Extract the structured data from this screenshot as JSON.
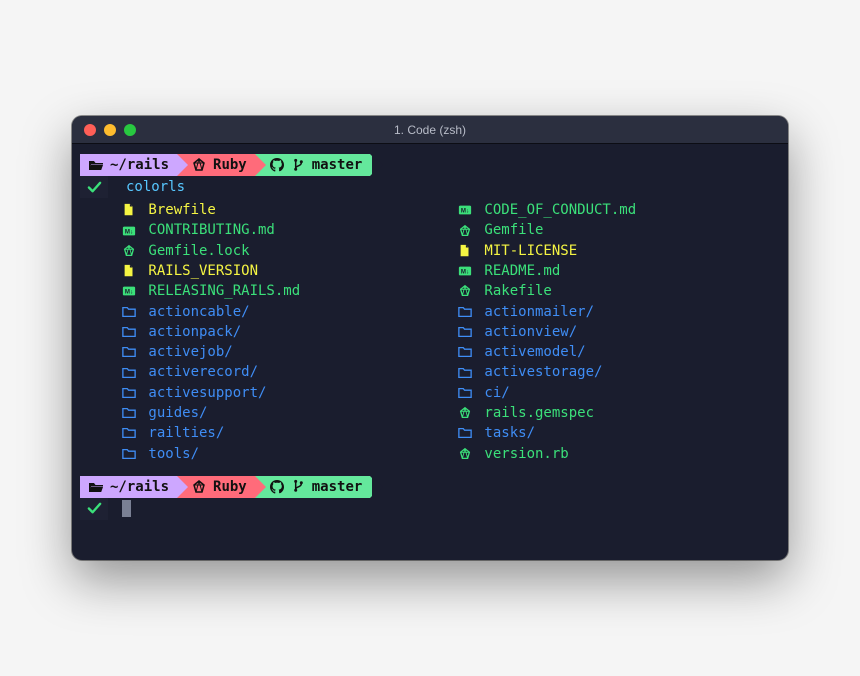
{
  "window": {
    "title": "1. Code (zsh)"
  },
  "prompt": {
    "path": "~/rails",
    "ruby": "Ruby",
    "branch": "master",
    "command": "colorls"
  },
  "listing": {
    "left": [
      {
        "icon": "file",
        "name": "Brewfile",
        "text": "yellow",
        "iconc": "yellow"
      },
      {
        "icon": "md",
        "name": "CONTRIBUTING.md",
        "text": "green",
        "iconc": "green"
      },
      {
        "icon": "gem",
        "name": "Gemfile.lock",
        "text": "green",
        "iconc": "green"
      },
      {
        "icon": "file",
        "name": "RAILS_VERSION",
        "text": "yellow",
        "iconc": "yellow"
      },
      {
        "icon": "md",
        "name": "RELEASING_RAILS.md",
        "text": "green",
        "iconc": "green"
      },
      {
        "icon": "folder",
        "name": "actioncable/",
        "text": "blue",
        "iconc": "blue"
      },
      {
        "icon": "folder",
        "name": "actionpack/",
        "text": "blue",
        "iconc": "blue"
      },
      {
        "icon": "folder",
        "name": "activejob/",
        "text": "blue",
        "iconc": "blue"
      },
      {
        "icon": "folder",
        "name": "activerecord/",
        "text": "blue",
        "iconc": "blue"
      },
      {
        "icon": "folder",
        "name": "activesupport/",
        "text": "blue",
        "iconc": "blue"
      },
      {
        "icon": "folder",
        "name": "guides/",
        "text": "blue",
        "iconc": "blue"
      },
      {
        "icon": "folder",
        "name": "railties/",
        "text": "blue",
        "iconc": "blue"
      },
      {
        "icon": "folder",
        "name": "tools/",
        "text": "blue",
        "iconc": "blue"
      }
    ],
    "right": [
      {
        "icon": "md",
        "name": "CODE_OF_CONDUCT.md",
        "text": "green",
        "iconc": "green"
      },
      {
        "icon": "gem",
        "name": "Gemfile",
        "text": "green",
        "iconc": "green"
      },
      {
        "icon": "file",
        "name": "MIT-LICENSE",
        "text": "yellow",
        "iconc": "yellow"
      },
      {
        "icon": "md",
        "name": "README.md",
        "text": "green",
        "iconc": "green"
      },
      {
        "icon": "gem",
        "name": "Rakefile",
        "text": "green",
        "iconc": "green"
      },
      {
        "icon": "folder",
        "name": "actionmailer/",
        "text": "blue",
        "iconc": "blue"
      },
      {
        "icon": "folder",
        "name": "actionview/",
        "text": "blue",
        "iconc": "blue"
      },
      {
        "icon": "folder",
        "name": "activemodel/",
        "text": "blue",
        "iconc": "blue"
      },
      {
        "icon": "folder",
        "name": "activestorage/",
        "text": "blue",
        "iconc": "blue"
      },
      {
        "icon": "folder",
        "name": "ci/",
        "text": "blue",
        "iconc": "blue"
      },
      {
        "icon": "gem",
        "name": "rails.gemspec",
        "text": "green",
        "iconc": "green"
      },
      {
        "icon": "folder",
        "name": "tasks/",
        "text": "blue",
        "iconc": "blue"
      },
      {
        "icon": "gem",
        "name": "version.rb",
        "text": "green",
        "iconc": "green"
      }
    ]
  }
}
